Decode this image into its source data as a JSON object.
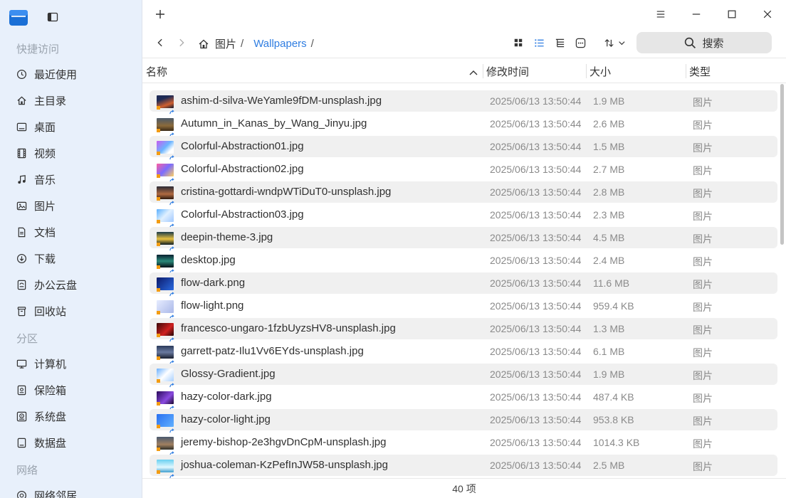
{
  "sidebar": {
    "groups": {
      "quick": "快捷访问",
      "partitions": "分区",
      "network": "网络"
    },
    "items": [
      {
        "label": "最近使用",
        "icon": "clock-icon"
      },
      {
        "label": "主目录",
        "icon": "home-icon"
      },
      {
        "label": "桌面",
        "icon": "desktop-icon"
      },
      {
        "label": "视频",
        "icon": "film-icon"
      },
      {
        "label": "音乐",
        "icon": "music-icon"
      },
      {
        "label": "图片",
        "icon": "image-icon"
      },
      {
        "label": "文档",
        "icon": "document-icon"
      },
      {
        "label": "下载",
        "icon": "download-icon"
      },
      {
        "label": "办公云盘",
        "icon": "cloud-drive-icon"
      },
      {
        "label": "回收站",
        "icon": "trash-icon"
      },
      {
        "label": "计算机",
        "icon": "computer-icon"
      },
      {
        "label": "保险箱",
        "icon": "vault-icon"
      },
      {
        "label": "系统盘",
        "icon": "system-disk-icon"
      },
      {
        "label": "数据盘",
        "icon": "data-disk-icon"
      },
      {
        "label": "网络邻居",
        "icon": "network-icon"
      }
    ]
  },
  "titlebar": {
    "new_tab": "+"
  },
  "breadcrumb": {
    "root": "图片",
    "current": "Wallpapers",
    "sep": "/"
  },
  "search": {
    "label": "搜索"
  },
  "columns": {
    "name": "名称",
    "modified": "修改时间",
    "size": "大小",
    "type": "类型"
  },
  "files": [
    {
      "name": "ashim-d-silva-WeYamle9fDM-unsplash.jpg",
      "date": "2025/06/13 13:50:44",
      "size": "1.9 MB",
      "type": "图片"
    },
    {
      "name": "Autumn_in_Kanas_by_Wang_Jinyu.jpg",
      "date": "2025/06/13 13:50:44",
      "size": "2.6 MB",
      "type": "图片"
    },
    {
      "name": "Colorful-Abstraction01.jpg",
      "date": "2025/06/13 13:50:44",
      "size": "1.5 MB",
      "type": "图片"
    },
    {
      "name": "Colorful-Abstraction02.jpg",
      "date": "2025/06/13 13:50:44",
      "size": "2.7 MB",
      "type": "图片"
    },
    {
      "name": "cristina-gottardi-wndpWTiDuT0-unsplash.jpg",
      "date": "2025/06/13 13:50:44",
      "size": "2.8 MB",
      "type": "图片"
    },
    {
      "name": "Colorful-Abstraction03.jpg",
      "date": "2025/06/13 13:50:44",
      "size": "2.3 MB",
      "type": "图片"
    },
    {
      "name": "deepin-theme-3.jpg",
      "date": "2025/06/13 13:50:44",
      "size": "4.5 MB",
      "type": "图片"
    },
    {
      "name": "desktop.jpg",
      "date": "2025/06/13 13:50:44",
      "size": "2.4 MB",
      "type": "图片"
    },
    {
      "name": "flow-dark.png",
      "date": "2025/06/13 13:50:44",
      "size": "11.6 MB",
      "type": "图片"
    },
    {
      "name": "flow-light.png",
      "date": "2025/06/13 13:50:44",
      "size": "959.4 KB",
      "type": "图片"
    },
    {
      "name": "francesco-ungaro-1fzbUyzsHV8-unsplash.jpg",
      "date": "2025/06/13 13:50:44",
      "size": "1.3 MB",
      "type": "图片"
    },
    {
      "name": "garrett-patz-Ilu1Vv6EYds-unsplash.jpg",
      "date": "2025/06/13 13:50:44",
      "size": "6.1 MB",
      "type": "图片"
    },
    {
      "name": "Glossy-Gradient.jpg",
      "date": "2025/06/13 13:50:44",
      "size": "1.9 MB",
      "type": "图片"
    },
    {
      "name": "hazy-color-dark.jpg",
      "date": "2025/06/13 13:50:44",
      "size": "487.4 KB",
      "type": "图片"
    },
    {
      "name": "hazy-color-light.jpg",
      "date": "2025/06/13 13:50:44",
      "size": "953.8 KB",
      "type": "图片"
    },
    {
      "name": "jeremy-bishop-2e3hgvDnCpM-unsplash.jpg",
      "date": "2025/06/13 13:50:44",
      "size": "1014.3 KB",
      "type": "图片"
    },
    {
      "name": "joshua-coleman-KzPefInJW58-unsplash.jpg",
      "date": "2025/06/13 13:50:44",
      "size": "2.5 MB",
      "type": "图片"
    }
  ],
  "status": {
    "count": "40 项"
  },
  "colors": {
    "accent": "#2f7de1",
    "sidebar_bg": "#e8f0fb",
    "row_alt": "#f0f0f0"
  }
}
